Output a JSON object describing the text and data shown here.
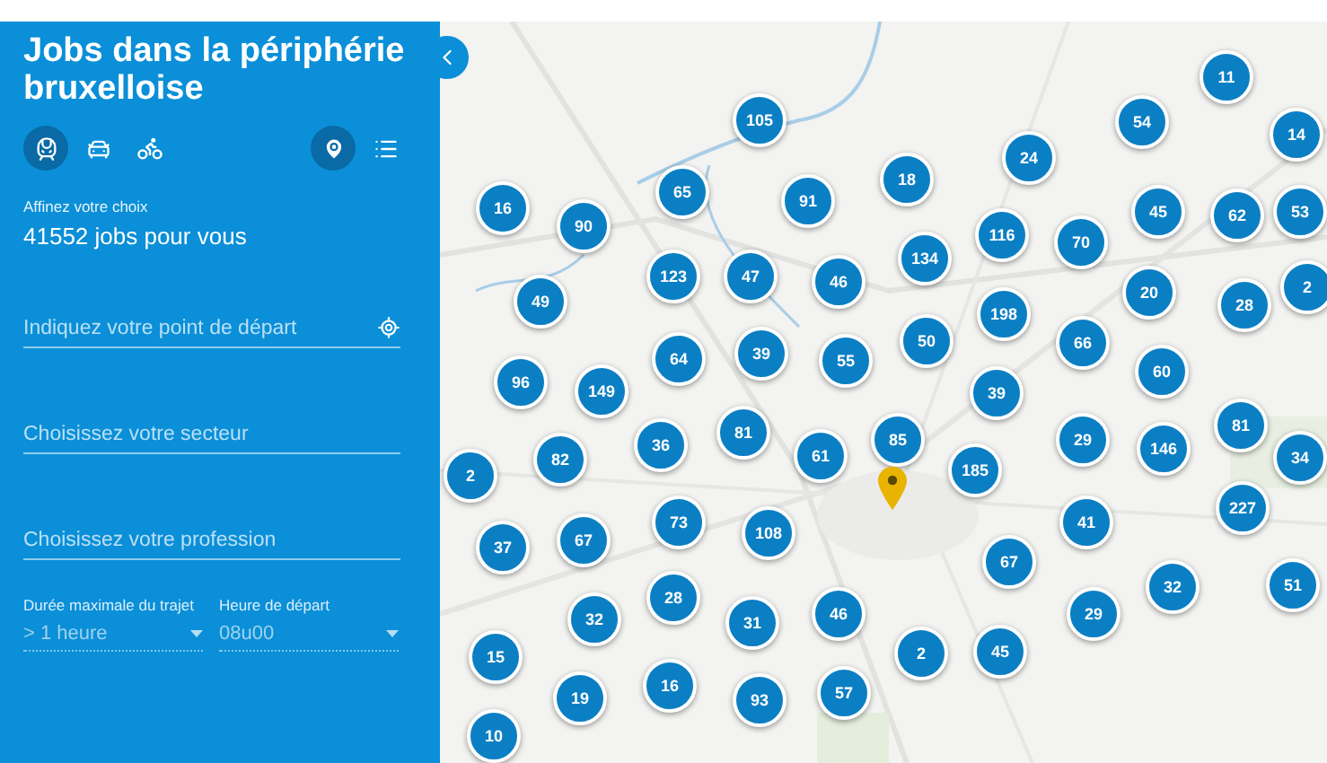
{
  "panel": {
    "title": "Jobs dans la périphérie bruxelloise",
    "transport_modes": [
      {
        "kind": "train",
        "selected": true
      },
      {
        "kind": "car",
        "selected": false
      },
      {
        "kind": "bike",
        "selected": false
      }
    ],
    "views": [
      {
        "kind": "map",
        "selected": true
      },
      {
        "kind": "list",
        "selected": false
      }
    ],
    "subtitle": "Affinez votre choix",
    "count": "41552 jobs pour vous",
    "fields": [
      {
        "kind": "location",
        "placeholder": "Indiquez votre point de départ"
      },
      {
        "kind": "text",
        "placeholder": "Choisissez votre secteur"
      },
      {
        "kind": "text",
        "placeholder": "Choisissez votre profession"
      }
    ],
    "selects": [
      {
        "label": "Durée maximale du trajet",
        "value": "> 1 heure"
      },
      {
        "label": "Heure de départ",
        "value": "08u00"
      }
    ]
  },
  "map": {
    "kind": "picture",
    "clusters": [
      "11",
      "105",
      "54",
      "14",
      "65",
      "18",
      "24",
      "16",
      "90",
      "91",
      "116",
      "45",
      "62",
      "53",
      "123",
      "47",
      "134",
      "70",
      "49",
      "46",
      "198",
      "20",
      "28",
      "2",
      "64",
      "39",
      "55",
      "50",
      "66",
      "60",
      "96",
      "149",
      "39",
      "82",
      "36",
      "81",
      "61",
      "85",
      "29",
      "146",
      "81",
      "34",
      "2",
      "185",
      "227",
      "37",
      "67",
      "73",
      "108",
      "41",
      "28",
      "67",
      "32",
      "51",
      "32",
      "31",
      "46",
      "29",
      "15",
      "16",
      "2",
      "45",
      "19",
      "93",
      "57",
      "10"
    ]
  }
}
